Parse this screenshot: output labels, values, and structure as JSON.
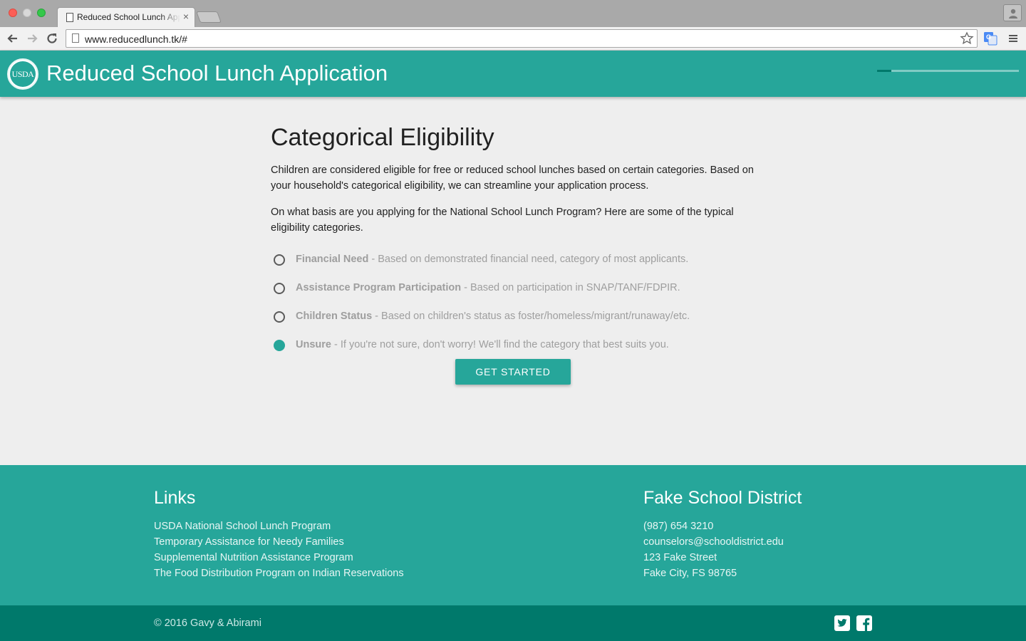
{
  "browser": {
    "tab_title": "Reduced School Lunch Application",
    "tab_close": "×",
    "url": "www.reducedlunch.tk/#"
  },
  "header": {
    "logo_text": "USDA",
    "title": "Reduced School Lunch Application",
    "progress_fraction": 0.1
  },
  "main": {
    "title": "Categorical Eligibility",
    "intro": "Children are considered eligible for free or reduced school lunches based on certain categories. Based on your household's categorical eligibility, we can streamline your application process.",
    "question": "On what basis are you applying for the National School Lunch Program? Here are some of the typical eligibility categories.",
    "options": [
      {
        "name": "Financial Need",
        "desc": " - Based on demonstrated financial need, category of most applicants.",
        "selected": false
      },
      {
        "name": "Assistance Program Participation",
        "desc": " - Based on participation in SNAP/TANF/FDPIR.",
        "selected": false
      },
      {
        "name": "Children Status",
        "desc": " - Based on children's status as foster/homeless/migrant/runaway/etc.",
        "selected": false
      },
      {
        "name": "Unsure",
        "desc": " - If you're not sure, don't worry! We'll find the category that best suits you.",
        "selected": true
      }
    ],
    "button_label": "GET STARTED"
  },
  "footer": {
    "links_heading": "Links",
    "links": [
      "USDA National School Lunch Program",
      "Temporary Assistance for Needy Families",
      "Supplemental Nutrition Assistance Program",
      "The Food Distribution Program on Indian Reservations"
    ],
    "district_heading": "Fake School District",
    "district_lines": [
      "(987) 654 3210",
      "counselors@schooldistrict.edu",
      "123 Fake Street",
      "Fake City, FS 98765"
    ],
    "copyright": "© 2016 Gavy & Abirami",
    "social_icons": [
      "twitter-icon",
      "facebook-icon"
    ]
  },
  "colors": {
    "primary": "#26a69a",
    "primary_dark": "#00796b",
    "primary_light": "#80cbc4",
    "background": "#eeeeee"
  }
}
